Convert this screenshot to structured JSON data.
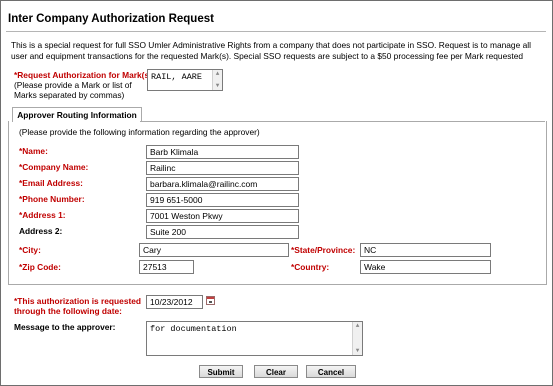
{
  "title": "Inter Company Authorization Request",
  "intro": "This is a special request for full SSO Umler Administrative Rights from a company that does not participate in SSO. Request is to manage all user and equipment transactions for the requested Mark(s). Special SSO requests are subject to a $50 processing fee per Mark requested",
  "marks": {
    "label": "*Request Authorization for Mark(s):",
    "hint": "(Please provide a Mark or list of Marks separated by commas)",
    "value": "RAIL, AARE"
  },
  "approver": {
    "tab_label": "Approver Routing Information",
    "instruction": "(Please provide the following information regarding the approver)",
    "fields": {
      "name": {
        "label": "*Name:",
        "value": "Barb Klimala"
      },
      "company": {
        "label": "*Company Name:",
        "value": "Railinc"
      },
      "email": {
        "label": "*Email Address:",
        "value": "barbara.klimala@railinc.com"
      },
      "phone": {
        "label": "*Phone Number:",
        "value": "919 651-5000"
      },
      "address1": {
        "label": "*Address 1:",
        "value": "7001 Weston Pkwy"
      },
      "address2": {
        "label": "Address 2:",
        "value": "Suite 200"
      },
      "city": {
        "label": "*City:",
        "value": "Cary"
      },
      "state": {
        "label": "*State/Province:",
        "value": "NC"
      },
      "zip": {
        "label": "*Zip Code:",
        "value": "27513"
      },
      "country": {
        "label": "*Country:",
        "value": "Wake"
      }
    }
  },
  "date": {
    "label": "*This authorization is requested through the following date:",
    "value": "10/23/2012"
  },
  "message": {
    "label": "Message to the approver:",
    "value": "for documentation"
  },
  "buttons": {
    "submit": "Submit",
    "clear": "Clear",
    "cancel": "Cancel"
  }
}
